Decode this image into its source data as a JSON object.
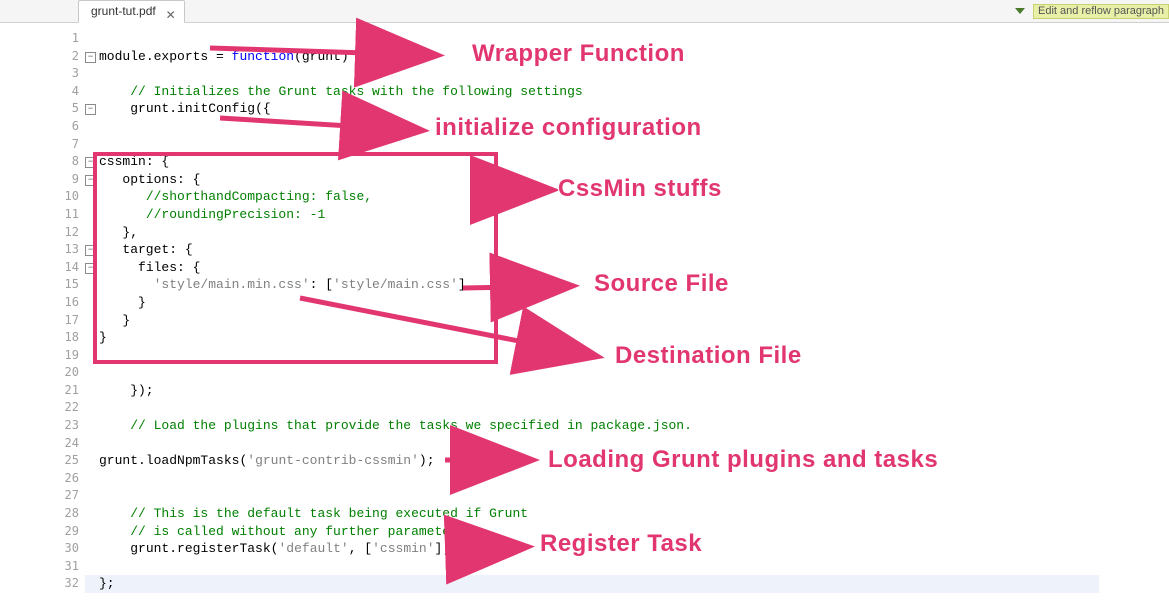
{
  "tab": {
    "title": "grunt-tut.pdf",
    "close_glyph": "✕"
  },
  "top_tools": {
    "tri_icon": "chevron-down",
    "sticky": "Edit and reflow\nparagraph"
  },
  "code": {
    "tokens": [
      [],
      [
        [
          "nm",
          "module"
        ],
        [
          "op",
          "."
        ],
        [
          "nm",
          "exports"
        ],
        [
          "op",
          " = "
        ],
        [
          "kw",
          "function"
        ],
        [
          "op",
          "("
        ],
        [
          "nm",
          "grunt"
        ],
        [
          "op",
          ") {"
        ]
      ],
      [],
      [
        [
          "op",
          "    "
        ],
        [
          "cm",
          "// Initializes the Grunt tasks with the following settings"
        ]
      ],
      [
        [
          "op",
          "    "
        ],
        [
          "nm",
          "grunt"
        ],
        [
          "op",
          "."
        ],
        [
          "nm",
          "initConfig"
        ],
        [
          "op",
          "({"
        ]
      ],
      [],
      [],
      [
        [
          "prop",
          "cssmin"
        ],
        [
          "op",
          ": {"
        ]
      ],
      [
        [
          "op",
          "   "
        ],
        [
          "prop",
          "options"
        ],
        [
          "op",
          ": {"
        ]
      ],
      [
        [
          "op",
          "      "
        ],
        [
          "cm",
          "//shorthandCompacting: false,"
        ]
      ],
      [
        [
          "op",
          "      "
        ],
        [
          "cm",
          "//roundingPrecision: -1"
        ]
      ],
      [
        [
          "op",
          "   },"
        ]
      ],
      [
        [
          "op",
          "   "
        ],
        [
          "prop",
          "target"
        ],
        [
          "op",
          ": {"
        ]
      ],
      [
        [
          "op",
          "     "
        ],
        [
          "prop",
          "files"
        ],
        [
          "op",
          ": {"
        ]
      ],
      [
        [
          "op",
          "       "
        ],
        [
          "str",
          "'style/main.min.css'"
        ],
        [
          "op",
          ": ["
        ],
        [
          "str",
          "'style/main.css'"
        ],
        [
          "op",
          "]"
        ]
      ],
      [
        [
          "op",
          "     }"
        ]
      ],
      [
        [
          "op",
          "   }"
        ]
      ],
      [
        [
          "op",
          "}"
        ]
      ],
      [],
      [],
      [
        [
          "op",
          "    });"
        ]
      ],
      [],
      [
        [
          "op",
          "    "
        ],
        [
          "cm",
          "// Load the plugins that provide the tasks we specified in package.json."
        ]
      ],
      [],
      [
        [
          "nm",
          "grunt"
        ],
        [
          "op",
          "."
        ],
        [
          "nm",
          "loadNpmTasks"
        ],
        [
          "op",
          "("
        ],
        [
          "str",
          "'grunt-contrib-cssmin'"
        ],
        [
          "op",
          ");"
        ]
      ],
      [],
      [],
      [
        [
          "op",
          "    "
        ],
        [
          "cm",
          "// This is the default task being executed if Grunt"
        ]
      ],
      [
        [
          "op",
          "    "
        ],
        [
          "cm",
          "// is called without any further parameter."
        ]
      ],
      [
        [
          "op",
          "    "
        ],
        [
          "nm",
          "grunt"
        ],
        [
          "op",
          "."
        ],
        [
          "nm",
          "registerTask"
        ],
        [
          "op",
          "("
        ],
        [
          "str",
          "'default'"
        ],
        [
          "op",
          ", ["
        ],
        [
          "str",
          "'cssmin'"
        ],
        [
          "op",
          "]);"
        ]
      ],
      [],
      [
        [
          "op",
          "};"
        ]
      ]
    ],
    "fold_lines": [
      2,
      5,
      8,
      9,
      13,
      14
    ],
    "line_count": 32,
    "highlight_line": 32
  },
  "annotations": {
    "wrapper": "Wrapper Function",
    "init": "initialize configuration",
    "cssmin": "CssMin stuffs",
    "source": "Source File",
    "dest": "Destination File",
    "loading": "Loading Grunt plugins and tasks",
    "register": "Register Task"
  }
}
